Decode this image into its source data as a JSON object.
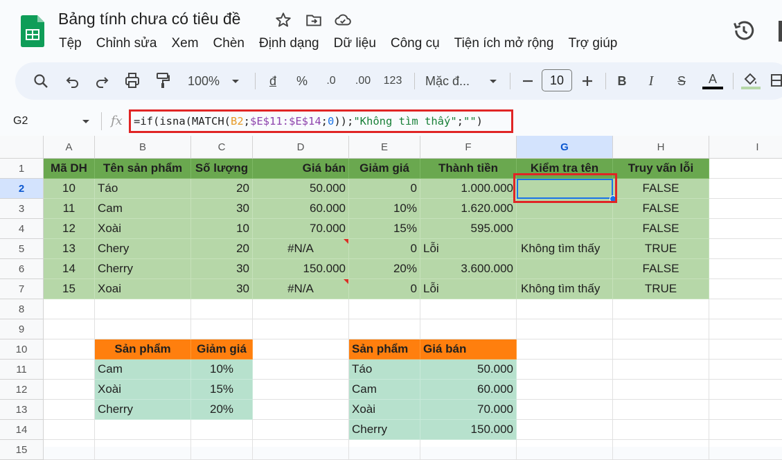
{
  "app": {
    "doc_title": "Bảng tính chưa có tiêu đề",
    "menus": [
      "Tệp",
      "Chỉnh sửa",
      "Xem",
      "Chèn",
      "Định dạng",
      "Dữ liệu",
      "Công cụ",
      "Tiện ích mở rộng",
      "Trợ giúp"
    ]
  },
  "toolbar": {
    "zoom": "100%",
    "currency": "đ",
    "percent": "%",
    "dec_decrease": ".0",
    "dec_increase": ".00",
    "num_format": "123",
    "font": "Mặc đ...",
    "font_size": "10",
    "bold": "B",
    "italic": "I",
    "strike": "S",
    "text_color_glyph": "A",
    "text_color": "#000000"
  },
  "formula_bar": {
    "cell_ref": "G2",
    "fx": "fx",
    "f1": "=if(isna(MATCH(",
    "f2": "B2",
    "f3": ";",
    "f4": "$E$11:$E$14",
    "f5": ";",
    "f6": "0",
    "f7": "));",
    "f8": "\"Không tìm thấy\"",
    "f9": ";",
    "f10": "\"\"",
    "f11": ")"
  },
  "columns": [
    "A",
    "B",
    "C",
    "D",
    "E",
    "F",
    "G",
    "H",
    "I"
  ],
  "rows": [
    "1",
    "2",
    "3",
    "4",
    "5",
    "6",
    "7",
    "8",
    "9",
    "10",
    "11",
    "12",
    "13",
    "14",
    "15"
  ],
  "main_table": {
    "headers": [
      "Mã DH",
      "Tên sản phẩm",
      "Số lượng",
      "Giá bán",
      "Giảm giá",
      "Thành tiền",
      "Kiểm tra tên",
      "Truy vấn lỗi"
    ],
    "rows": [
      [
        "10",
        "Táo",
        "20",
        "50.000",
        "0",
        "1.000.000",
        "",
        "FALSE"
      ],
      [
        "11",
        "Cam",
        "30",
        "60.000",
        "10%",
        "1.620.000",
        "",
        "FALSE"
      ],
      [
        "12",
        "Xoài",
        "10",
        "70.000",
        "15%",
        "595.000",
        "",
        "FALSE"
      ],
      [
        "13",
        "Chery",
        "20",
        "#N/A",
        "0",
        "Lỗi",
        "Không tìm thấy",
        "TRUE"
      ],
      [
        "14",
        "Cherry",
        "30",
        "150.000",
        "20%",
        "3.600.000",
        "",
        "FALSE"
      ],
      [
        "15",
        "Xoai",
        "30",
        "#N/A",
        "0",
        "Lỗi",
        "Không tìm thấy",
        "TRUE"
      ]
    ]
  },
  "discount_table": {
    "headers": [
      "Sản phẩm",
      "Giảm giá"
    ],
    "rows": [
      [
        "Cam",
        "10%"
      ],
      [
        "Xoài",
        "15%"
      ],
      [
        "Cherry",
        "20%"
      ]
    ]
  },
  "price_table": {
    "headers": [
      "Sản phẩm",
      "Giá bán"
    ],
    "rows": [
      [
        "Táo",
        "50.000"
      ],
      [
        "Cam",
        "60.000"
      ],
      [
        "Xoài",
        "70.000"
      ],
      [
        "Cherry",
        "150.000"
      ]
    ]
  },
  "colors": {
    "header_green": "#6aa84f",
    "data_green": "#b6d7a8",
    "header_orange": "#ff7f0e",
    "lookup_teal": "#b7e1cd",
    "highlight_red": "#e02525",
    "selection_blue": "#1a73e8"
  }
}
